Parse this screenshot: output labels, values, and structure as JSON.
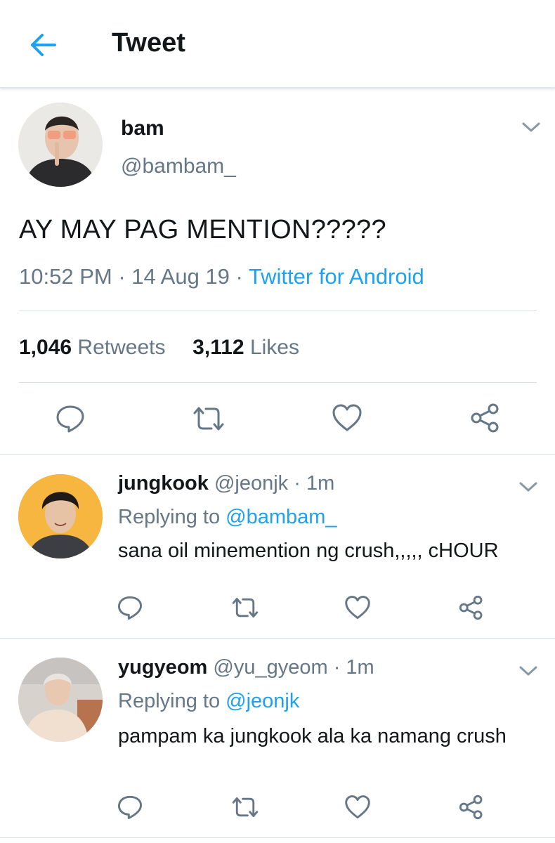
{
  "header": {
    "title": "Tweet"
  },
  "tweet": {
    "name": "bam",
    "handle": "@bambam_",
    "text": "AY MAY PAG MENTION?????",
    "time": "10:52 PM",
    "date": "14 Aug 19",
    "source": "Twitter for Android",
    "retweets_count": "1,046",
    "retweets_label": "Retweets",
    "likes_count": "3,112",
    "likes_label": "Likes"
  },
  "replies": [
    {
      "name": "jungkook",
      "handle": "@jeonjk",
      "age": "1m",
      "replying_prefix": "Replying to",
      "replying_to": "@bambam_",
      "text": "sana oil minemention ng crush,,,,, cHOUR"
    },
    {
      "name": "yugyeom",
      "handle": "@yu_gyeom",
      "age": "1m",
      "replying_prefix": "Replying to",
      "replying_to": "@jeonjk",
      "text": "pampam ka jungkook ala ka namang crush"
    }
  ],
  "icons": {
    "back": "arrow-left-icon",
    "caret": "chevron-down-icon",
    "reply": "reply-bubble-icon",
    "retweet": "retweet-icon",
    "like": "heart-icon",
    "share": "share-icon"
  },
  "colors": {
    "accent": "#1da1f2",
    "muted": "#657786",
    "text": "#14171a",
    "divider": "#d9dee2"
  }
}
